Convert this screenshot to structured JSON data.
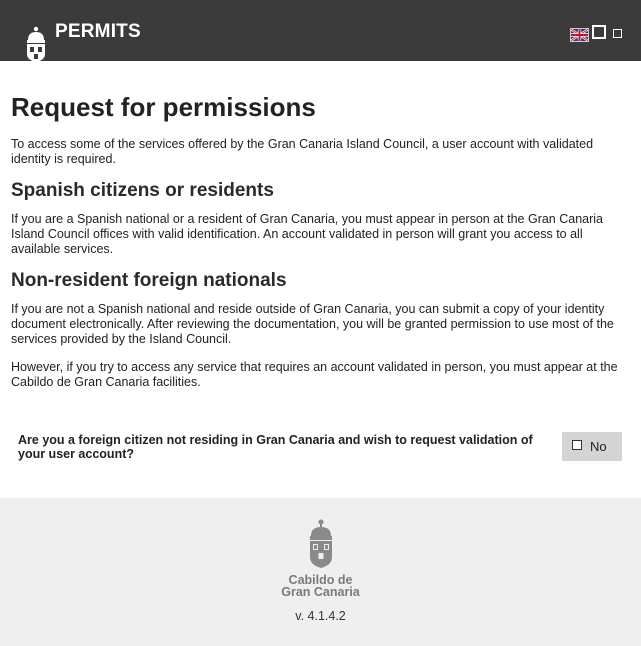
{
  "header": {
    "title": "PERMITS",
    "language_icon": "uk-flag-icon",
    "window_icons": [
      "square-outline-icon",
      "square-small-icon"
    ]
  },
  "content": {
    "heading": "Request for permissions",
    "intro": "To access some of the services offered by the Gran Canaria Island Council, a user account with validated identity is required.",
    "section1": {
      "title": "Spanish citizens or residents",
      "text": "If you are a Spanish national or a resident of Gran Canaria, you must appear in person at the Gran Canaria Island Council offices with valid identification. An account validated in person will grant you access to all available services."
    },
    "section2": {
      "title": "Non-resident foreign nationals",
      "text1": "If you are not a Spanish national and reside outside of Gran Canaria, you can submit a copy of your identity document electronically. After reviewing the documentation, you will be granted permission to use most of the services provided by the Island Council.",
      "text2": "However, if you try to access any service that requires an account validated in person, you must appear at the Cabildo de Gran Canaria facilities."
    },
    "question": "Are you a foreign citizen not residing in Gran Canaria and wish to request validation of your user account?",
    "answer_button": "No"
  },
  "footer": {
    "brand_line1": "Cabildo de",
    "brand_line2": "Gran Canaria",
    "version": "v. 4.1.4.2"
  },
  "colors": {
    "header_bg": "#3b3b3b",
    "footer_bg": "#efefef",
    "button_bg": "#d4d4d4",
    "brand_gray": "#7a7a7a"
  }
}
